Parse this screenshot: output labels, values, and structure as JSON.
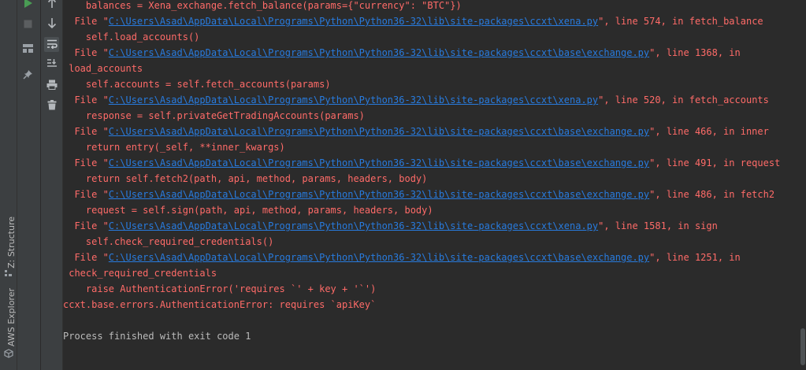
{
  "side_tabs": {
    "z_structure": "Z: Structure",
    "aws_explorer": "AWS Explorer"
  },
  "console": {
    "lines": [
      {
        "kind": "error",
        "pre": "    balances = Xena_exchange.fetch_balance(params={\"currency\": \"BTC\"})",
        "link": "",
        "post": ""
      },
      {
        "kind": "error",
        "pre": "  File \"",
        "link": "C:\\Users\\Asad\\AppData\\Local\\Programs\\Python\\Python36-32\\lib\\site-packages\\ccxt\\xena.py",
        "post": "\", line 574, in fetch_balance"
      },
      {
        "kind": "error",
        "pre": "    self.load_accounts()",
        "link": "",
        "post": ""
      },
      {
        "kind": "error",
        "pre": "  File \"",
        "link": "C:\\Users\\Asad\\AppData\\Local\\Programs\\Python\\Python36-32\\lib\\site-packages\\ccxt\\base\\exchange.py",
        "post": "\", line 1368, in"
      },
      {
        "kind": "error",
        "pre": " load_accounts",
        "link": "",
        "post": ""
      },
      {
        "kind": "error",
        "pre": "    self.accounts = self.fetch_accounts(params)",
        "link": "",
        "post": ""
      },
      {
        "kind": "error",
        "pre": "  File \"",
        "link": "C:\\Users\\Asad\\AppData\\Local\\Programs\\Python\\Python36-32\\lib\\site-packages\\ccxt\\xena.py",
        "post": "\", line 520, in fetch_accounts"
      },
      {
        "kind": "error",
        "pre": "    response = self.privateGetTradingAccounts(params)",
        "link": "",
        "post": ""
      },
      {
        "kind": "error",
        "pre": "  File \"",
        "link": "C:\\Users\\Asad\\AppData\\Local\\Programs\\Python\\Python36-32\\lib\\site-packages\\ccxt\\base\\exchange.py",
        "post": "\", line 466, in inner"
      },
      {
        "kind": "error",
        "pre": "    return entry(_self, **inner_kwargs)",
        "link": "",
        "post": ""
      },
      {
        "kind": "error",
        "pre": "  File \"",
        "link": "C:\\Users\\Asad\\AppData\\Local\\Programs\\Python\\Python36-32\\lib\\site-packages\\ccxt\\base\\exchange.py",
        "post": "\", line 491, in request"
      },
      {
        "kind": "error",
        "pre": "    return self.fetch2(path, api, method, params, headers, body)",
        "link": "",
        "post": ""
      },
      {
        "kind": "error",
        "pre": "  File \"",
        "link": "C:\\Users\\Asad\\AppData\\Local\\Programs\\Python\\Python36-32\\lib\\site-packages\\ccxt\\base\\exchange.py",
        "post": "\", line 486, in fetch2"
      },
      {
        "kind": "error",
        "pre": "    request = self.sign(path, api, method, params, headers, body)",
        "link": "",
        "post": ""
      },
      {
        "kind": "error",
        "pre": "  File \"",
        "link": "C:\\Users\\Asad\\AppData\\Local\\Programs\\Python\\Python36-32\\lib\\site-packages\\ccxt\\xena.py",
        "post": "\", line 1581, in sign"
      },
      {
        "kind": "error",
        "pre": "    self.check_required_credentials()",
        "link": "",
        "post": ""
      },
      {
        "kind": "error",
        "pre": "  File \"",
        "link": "C:\\Users\\Asad\\AppData\\Local\\Programs\\Python\\Python36-32\\lib\\site-packages\\ccxt\\base\\exchange.py",
        "post": "\", line 1251, in"
      },
      {
        "kind": "error",
        "pre": " check_required_credentials",
        "link": "",
        "post": ""
      },
      {
        "kind": "error",
        "pre": "    raise AuthenticationError('requires `' + key + '`')",
        "link": "",
        "post": ""
      },
      {
        "kind": "error",
        "pre": "ccxt.base.errors.AuthenticationError: requires `apiKey`",
        "link": "",
        "post": ""
      },
      {
        "kind": "normal",
        "pre": "",
        "link": "",
        "post": ""
      },
      {
        "kind": "normal",
        "pre": "Process finished with exit code 1",
        "link": "",
        "post": ""
      }
    ]
  },
  "colors": {
    "error_text": "#ff6b68",
    "link_text": "#287bde",
    "normal_text": "#bbbbbb",
    "background": "#2b2b2b",
    "panel": "#3c3f41",
    "run_green": "#499c54"
  },
  "icons": [
    "rerun-icon",
    "stop-icon",
    "layout-icon",
    "pin-icon",
    "scroll-up-icon",
    "scroll-down-icon",
    "soft-wrap-icon",
    "scroll-to-end-icon",
    "print-icon",
    "trash-icon",
    "structure-icon",
    "aws-icon"
  ]
}
